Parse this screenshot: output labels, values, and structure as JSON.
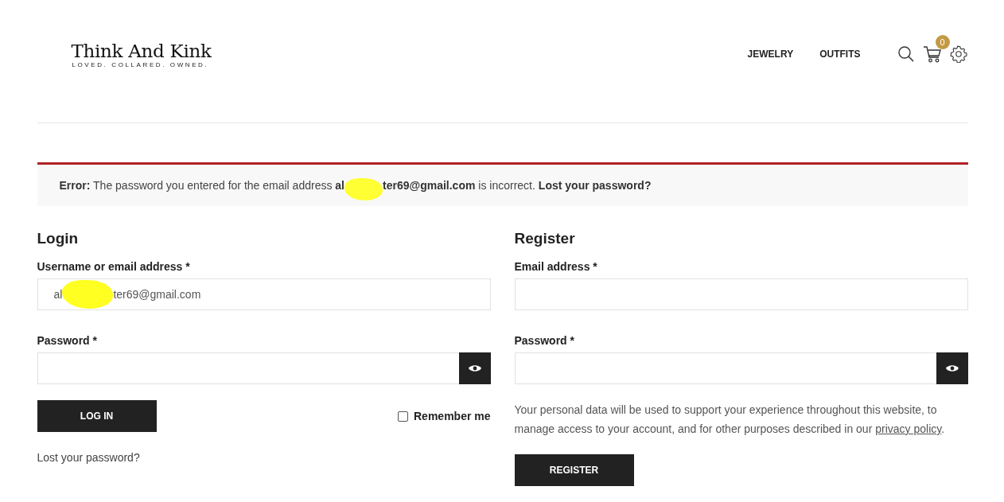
{
  "header": {
    "logo": {
      "name": "Think And Kink",
      "tagline": "LOVED. COLLARED. OWNED."
    },
    "nav": [
      {
        "label": "JEWELRY"
      },
      {
        "label": "OUTFITS"
      }
    ],
    "cart_count": "0"
  },
  "error": {
    "text_start": "**Error:** The password you entered for the email address **al**",
    "text_end": "**ter69@gmail.com** is incorrect.",
    "link": "Lost your password?"
  },
  "login": {
    "title": "Login",
    "username_label": "Username or email address *",
    "username_start": "al",
    "username_end": "ter69@gmail.com",
    "password_label": "Password *",
    "button": "LOG IN",
    "remember": {
      "label": "Remember me",
      "checked": false
    },
    "lost_link": "Lost your password?"
  },
  "register": {
    "title": "Register",
    "email_label": "Email address *",
    "password_label": "Password *",
    "privacy_text": "Your personal data will be used to support your experience throughout this website, to manage access to your account, and for other purposes described in our",
    "privacy_link": "privacy policy",
    "privacy_end": ".",
    "button": "REGISTER"
  }
}
